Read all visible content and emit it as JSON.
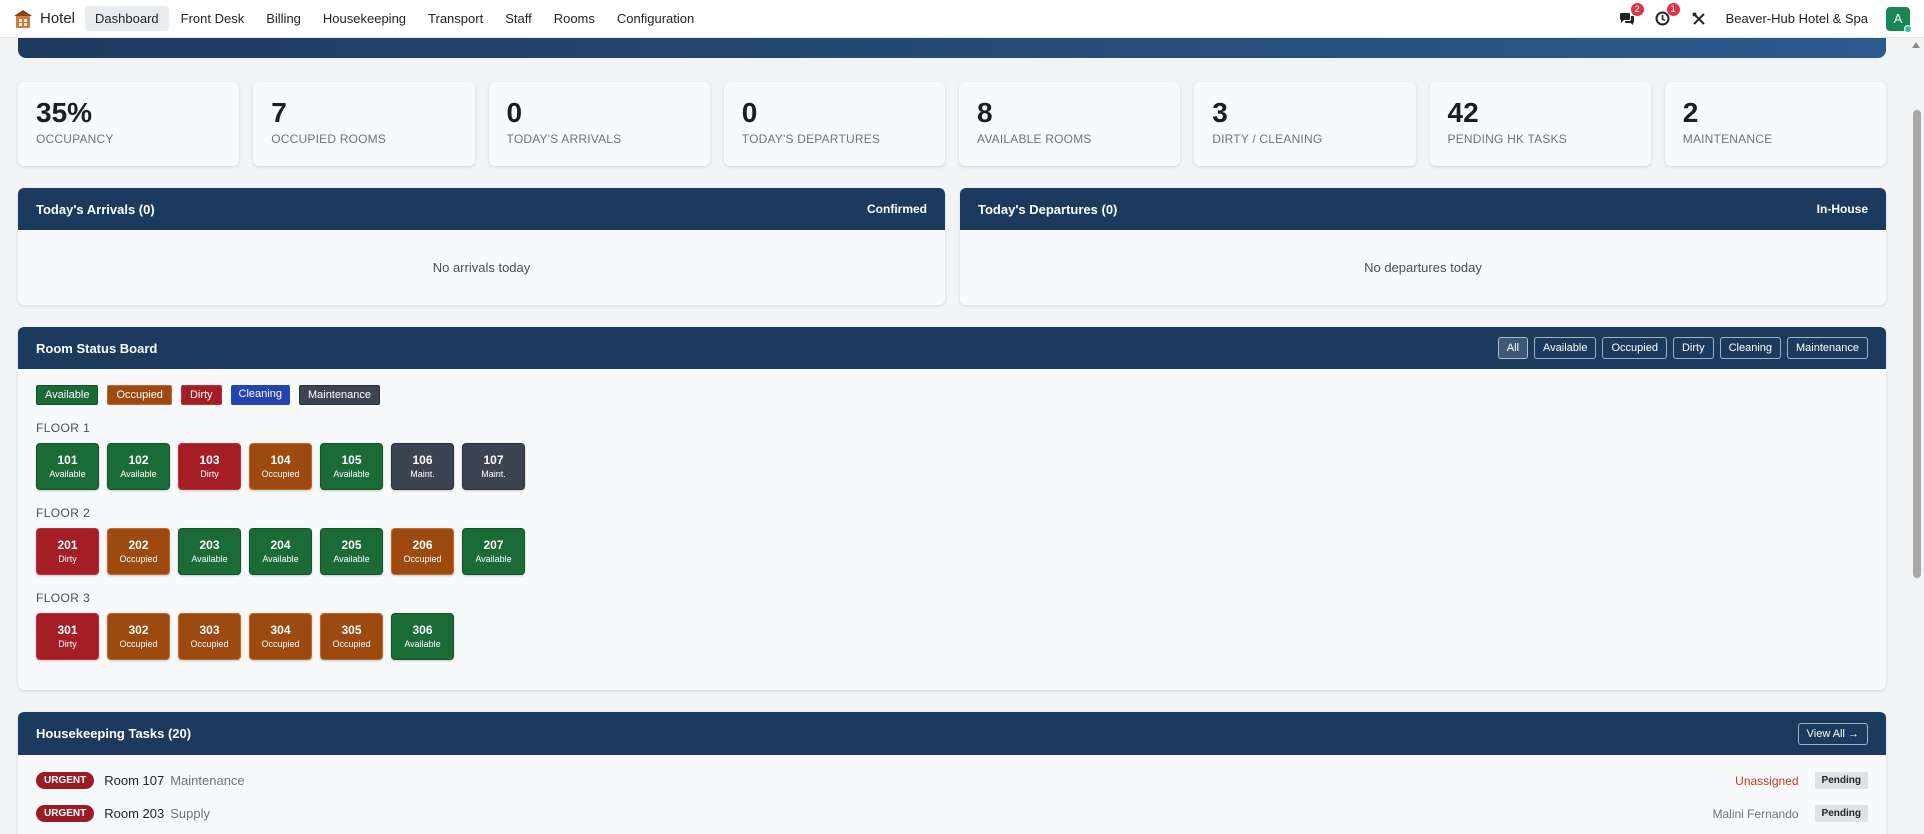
{
  "navbar": {
    "brand": "Hotel",
    "menu": [
      "Dashboard",
      "Front Desk",
      "Billing",
      "Housekeeping",
      "Transport",
      "Staff",
      "Rooms",
      "Configuration"
    ],
    "messages_count": "2",
    "alerts_count": "1",
    "hotel_name": "Beaver-Hub Hotel & Spa",
    "avatar_initial": "A"
  },
  "stats": [
    {
      "value": "35%",
      "label": "Occupancy"
    },
    {
      "value": "7",
      "label": "Occupied Rooms"
    },
    {
      "value": "0",
      "label": "Today's Arrivals"
    },
    {
      "value": "0",
      "label": "Today's Departures"
    },
    {
      "value": "8",
      "label": "Available Rooms"
    },
    {
      "value": "3",
      "label": "Dirty / Cleaning"
    },
    {
      "value": "42",
      "label": "Pending HK Tasks"
    },
    {
      "value": "2",
      "label": "Maintenance"
    }
  ],
  "arrivals": {
    "title": "Today's Arrivals (0)",
    "tag": "Confirmed",
    "empty": "No arrivals today"
  },
  "departures": {
    "title": "Today's Departures (0)",
    "tag": "In-House",
    "empty": "No departures today"
  },
  "room_board": {
    "title": "Room Status Board",
    "filters": [
      "All",
      "Available",
      "Occupied",
      "Dirty",
      "Cleaning",
      "Maintenance"
    ],
    "legend": [
      "Available",
      "Occupied",
      "Dirty",
      "Cleaning",
      "Maintenance"
    ],
    "floors": [
      {
        "label": "FLOOR 1",
        "rooms": [
          {
            "num": "101",
            "status": "Available"
          },
          {
            "num": "102",
            "status": "Available"
          },
          {
            "num": "103",
            "status": "Dirty"
          },
          {
            "num": "104",
            "status": "Occupied"
          },
          {
            "num": "105",
            "status": "Available"
          },
          {
            "num": "106",
            "status": "Maint."
          },
          {
            "num": "107",
            "status": "Maint."
          }
        ]
      },
      {
        "label": "FLOOR 2",
        "rooms": [
          {
            "num": "201",
            "status": "Dirty"
          },
          {
            "num": "202",
            "status": "Occupied"
          },
          {
            "num": "203",
            "status": "Available"
          },
          {
            "num": "204",
            "status": "Available"
          },
          {
            "num": "205",
            "status": "Available"
          },
          {
            "num": "206",
            "status": "Occupied"
          },
          {
            "num": "207",
            "status": "Available"
          }
        ]
      },
      {
        "label": "FLOOR 3",
        "rooms": [
          {
            "num": "301",
            "status": "Dirty"
          },
          {
            "num": "302",
            "status": "Occupied"
          },
          {
            "num": "303",
            "status": "Occupied"
          },
          {
            "num": "304",
            "status": "Occupied"
          },
          {
            "num": "305",
            "status": "Occupied"
          },
          {
            "num": "306",
            "status": "Available"
          }
        ]
      }
    ]
  },
  "hk_tasks": {
    "title": "Housekeeping Tasks (20)",
    "view_all": "View All →",
    "tasks": [
      {
        "priority": "URGENT",
        "room": "Room 107",
        "type": "Maintenance",
        "assignee": "Unassigned",
        "status": "Pending"
      },
      {
        "priority": "URGENT",
        "room": "Room 203",
        "type": "Supply",
        "assignee": "Malini Fernando",
        "status": "Pending"
      }
    ]
  },
  "colors": {
    "header_navy": "#1c3a5e",
    "available": "#1a6b36",
    "occupied": "#9c4a10",
    "dirty": "#a51e26",
    "cleaning": "#2444b0",
    "maintenance": "#3d4451",
    "unassigned": "#c0392b"
  }
}
